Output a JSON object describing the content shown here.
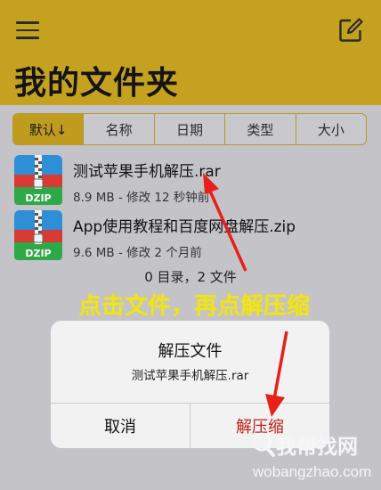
{
  "header": {
    "title": "我的文件夹"
  },
  "sort_tabs": [
    "默认↓",
    "名称",
    "日期",
    "类型",
    "大小"
  ],
  "files": [
    {
      "name": "测试苹果手机解压.rar",
      "meta": "8.9 MB - 修改 12 秒钟前",
      "icon_label": "DZIP"
    },
    {
      "name": "App使用教程和百度网盘解压.zip",
      "meta": "9.6 MB - 修改 2 个月前",
      "icon_label": "DZIP"
    }
  ],
  "summary": "0 目录，2 文件",
  "annotation": "点击文件，再点解压缩",
  "dialog": {
    "title": "解压文件",
    "message": "测试苹果手机解压.rar",
    "cancel": "取消",
    "confirm": "解压缩"
  },
  "watermark": {
    "name": "我帮找网",
    "url": "wobangzhao.com"
  },
  "colors": {
    "header": "#c4a11f",
    "annotation": "#f4e60a",
    "arrow": "#e8201a",
    "confirm": "#c0201a"
  },
  "icons": [
    "menu-icon",
    "compose-icon",
    "zip-file-icon",
    "search-icon"
  ]
}
